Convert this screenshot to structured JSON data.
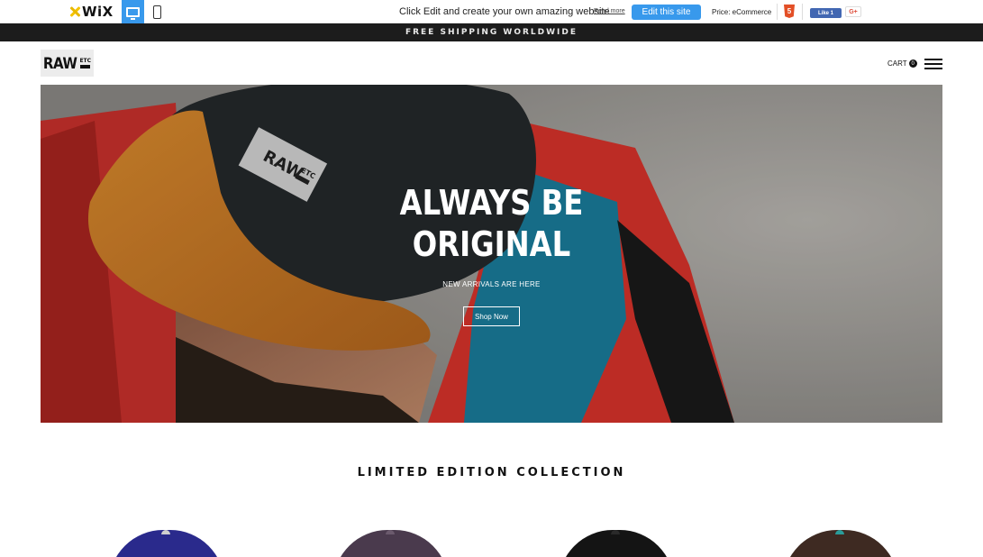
{
  "wix_bar": {
    "logo_text": "WiX",
    "promo_text": "Click Edit and create your own amazing website",
    "read_more": "Read more",
    "edit_button": "Edit this site",
    "price": "Price: eCommerce",
    "fb_like": "Like 1",
    "gplus": "G+"
  },
  "announcement": "FREE SHIPPING WORLDWIDE",
  "header": {
    "logo_main": "RAW",
    "logo_sub": "ETC",
    "cart_label": "CART",
    "cart_count": "0"
  },
  "hero": {
    "title_line1": "ALWAYS BE",
    "title_line2": "ORIGINAL",
    "subtitle": "NEW ARRIVALS ARE HERE",
    "button": "Shop Now",
    "cap_patch_main": "RAW",
    "cap_patch_sub": "ETC"
  },
  "collection": {
    "title": "LIMITED EDITION COLLECTION",
    "products": [
      {
        "color": "#2a2a8c",
        "button_color": "#cfcfcf"
      },
      {
        "color": "#4a3a4d",
        "button_color": "#6b5a6d"
      },
      {
        "color": "#141414",
        "button_color": "#2a2a2a"
      },
      {
        "color": "#3e2a22",
        "button_color": "#2a9c9a"
      }
    ]
  },
  "colors": {
    "wix_accent": "#3899ec",
    "announce_bg": "#1c1c1c"
  }
}
